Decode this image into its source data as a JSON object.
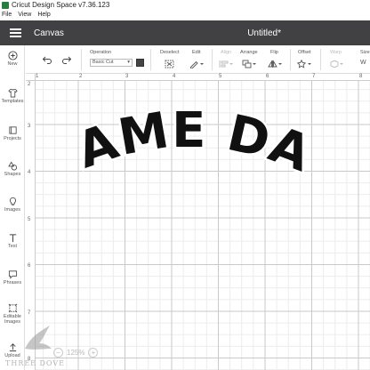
{
  "titlebar": {
    "title": "Cricut Design Space  v7.36.123"
  },
  "menubar": {
    "items": [
      "File",
      "View",
      "Help"
    ]
  },
  "header": {
    "canvas_label": "Canvas",
    "document_title": "Untitled*"
  },
  "sidebar": {
    "items": [
      {
        "label": "New",
        "icon": "plus-circle-icon"
      },
      {
        "label": "Templates",
        "icon": "shirt-icon"
      },
      {
        "label": "Projects",
        "icon": "projects-icon"
      },
      {
        "label": "Shapes",
        "icon": "shapes-icon"
      },
      {
        "label": "Images",
        "icon": "bulb-icon"
      },
      {
        "label": "Text",
        "icon": "text-icon"
      },
      {
        "label": "Phrases",
        "icon": "speech-icon"
      },
      {
        "label": "Editable Images",
        "icon": "editable-images-icon"
      },
      {
        "label": "Upload",
        "icon": "upload-icon"
      }
    ]
  },
  "toolbar": {
    "operation_label": "Operation",
    "operation_value": "Basic Cut",
    "deselect_label": "Deselect",
    "edit_label": "Edit",
    "align_label": "Align",
    "arrange_label": "Arrange",
    "flip_label": "Flip",
    "offset_label": "Offset",
    "warp_label": "Warp",
    "size_label": "Size",
    "swatch_color": "#444444"
  },
  "rulers": {
    "top": [
      "1",
      "2",
      "3",
      "4",
      "5",
      "6",
      "7",
      "8"
    ],
    "left": [
      "2",
      "3",
      "4",
      "5",
      "6",
      "7",
      "8"
    ]
  },
  "canvas": {
    "artwork_text": "GAME DAY"
  },
  "zoom": {
    "value": "125%",
    "minus": "−",
    "plus": "+"
  },
  "watermark": {
    "text": "THREE DOVE"
  }
}
